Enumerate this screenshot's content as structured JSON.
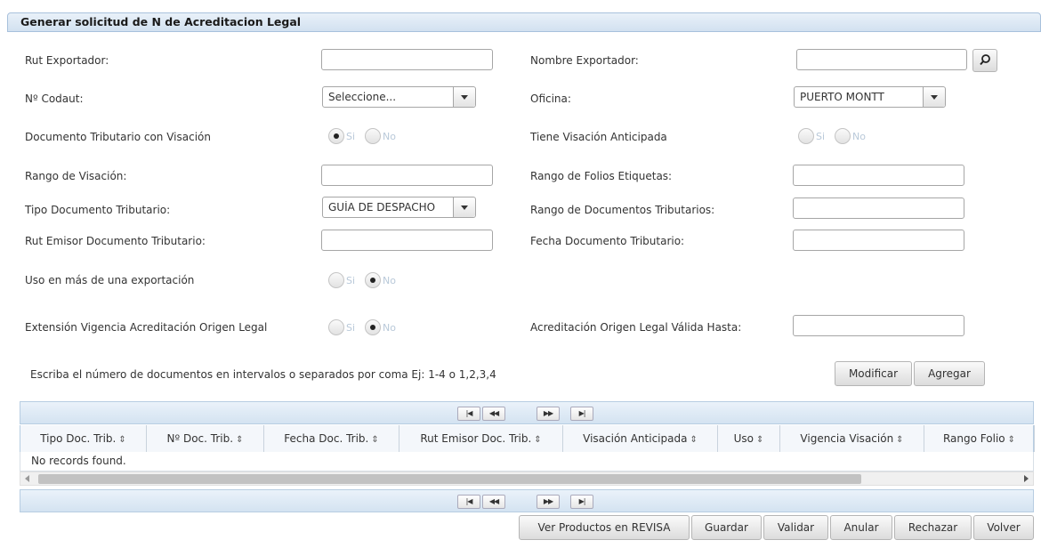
{
  "panel": {
    "title": "Generar solicitud de N de Acreditacion Legal"
  },
  "form": {
    "rut_exportador": {
      "label": "Rut Exportador:",
      "value": ""
    },
    "nombre_exportador": {
      "label": "Nombre Exportador:",
      "value": ""
    },
    "codaut": {
      "label": "Nº Codaut:",
      "selected": "Seleccione..."
    },
    "oficina": {
      "label": "Oficina:",
      "selected": "PUERTO MONTT"
    },
    "doc_tributario_visacion": {
      "label": "Documento Tributario con Visación",
      "yes": "Si",
      "no": "No",
      "value": "Si"
    },
    "visacion_anticipada": {
      "label": "Tiene Visación Anticipada",
      "yes": "Si",
      "no": "No",
      "value": ""
    },
    "rango_visacion": {
      "label": "Rango de Visación:",
      "value": ""
    },
    "rango_folios": {
      "label": "Rango de Folios Etiquetas:",
      "value": ""
    },
    "tipo_doc": {
      "label": "Tipo Documento Tributario:",
      "selected": "GUÍA DE DESPACHO"
    },
    "rango_docs": {
      "label": "Rango de Documentos Tributarios:",
      "value": ""
    },
    "rut_emisor": {
      "label": "Rut Emisor Documento Tributario:",
      "value": ""
    },
    "fecha_doc": {
      "label": "Fecha Documento Tributario:",
      "value": ""
    },
    "uso_mas_exportacion": {
      "label": "Uso en más de una exportación",
      "yes": "Si",
      "no": "No",
      "value": "No"
    },
    "extension_vigencia": {
      "label": "Extensión Vigencia Acreditación Origen Legal",
      "yes": "Si",
      "no": "No",
      "value": "No"
    },
    "valida_hasta": {
      "label": "Acreditación Origen Legal Válida Hasta:",
      "value": ""
    }
  },
  "hint": "Escriba el número de documentos en intervalos o separados por coma Ej: 1-4 o 1,2,3,4",
  "actions": {
    "modificar": "Modificar",
    "agregar": "Agregar"
  },
  "paginator": {
    "first": "|◀",
    "prev": "◀◀",
    "next": "▶▶",
    "last": "▶|"
  },
  "table": {
    "columns": [
      "Tipo Doc. Trib.",
      "Nº Doc. Trib.",
      "Fecha Doc. Trib.",
      "Rut Emisor Doc. Trib.",
      "Visación Anticipada",
      "Uso",
      "Vigencia Visación",
      "Rango Folio"
    ],
    "sort_icon": "⇕",
    "empty_message": "No records found."
  },
  "footer_buttons": {
    "ver_productos": "Ver Productos en REVISA",
    "guardar": "Guardar",
    "validar": "Validar",
    "anular": "Anular",
    "rechazar": "Rechazar",
    "volver": "Volver"
  },
  "icons": {
    "search": "search-icon"
  }
}
